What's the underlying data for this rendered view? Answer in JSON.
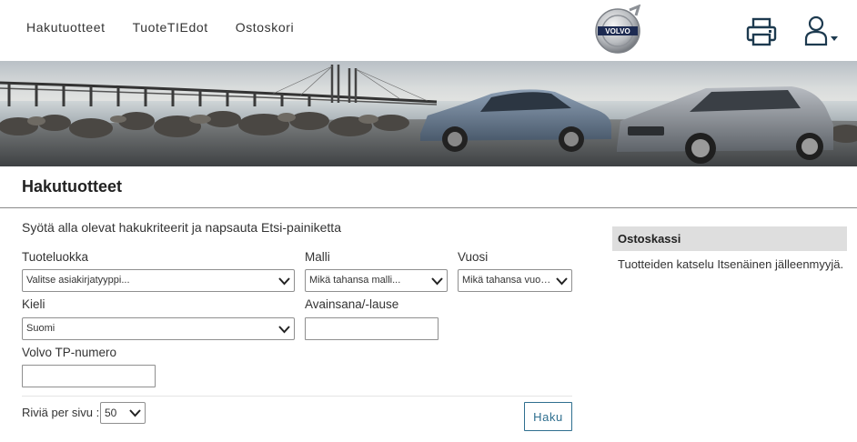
{
  "nav": {
    "items": [
      {
        "label": "Hakutuotteet"
      },
      {
        "label": "TuoteTIEdot"
      },
      {
        "label": "Ostoskori"
      }
    ]
  },
  "brand": {
    "logo_text": "VOLVO",
    "colors": {
      "accent": "#2f6f8f",
      "cart_header_bg": "#dedede"
    }
  },
  "icons": {
    "print": "printer-icon",
    "user": "user-icon",
    "caret": "caret-down-icon"
  },
  "page": {
    "title": "Hakutuotteet",
    "instructions": "Syötä alla olevat hakukriteerit ja napsauta Etsi-painiketta"
  },
  "form": {
    "product_category": {
      "label": "Tuoteluokka",
      "selected": "Valitse asiakirjatyyppi..."
    },
    "model": {
      "label": "Malli",
      "selected": "Mikä tahansa malli..."
    },
    "year": {
      "label": "Vuosi",
      "selected": "Mikä tahansa vuosi..."
    },
    "language": {
      "label": "Kieli",
      "selected": "Suomi"
    },
    "keyword": {
      "label": "Avainsana/-lause",
      "value": ""
    },
    "tp_number": {
      "label": "Volvo TP-numero",
      "value": ""
    },
    "rows_per_page": {
      "label": "Riviä per sivu :",
      "selected": "50"
    },
    "search_button": "Haku"
  },
  "cart": {
    "title": "Ostoskassi",
    "message": "Tuotteiden katselu Itsenäinen jälleenmyyjä."
  }
}
